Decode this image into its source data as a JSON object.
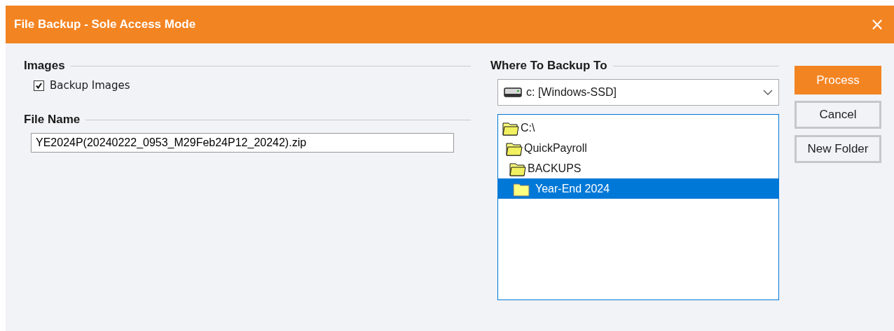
{
  "window": {
    "title": "File Backup - Sole Access Mode",
    "close": "×"
  },
  "images": {
    "heading": "Images",
    "checkbox": {
      "label": "Backup Images",
      "checked": true
    }
  },
  "file_name": {
    "heading": "File Name",
    "value": "YE2024P(20240222_0953_M29Feb24P12_20242).zip"
  },
  "destination": {
    "heading": "Where To Backup To",
    "drive": "c: [Windows-SSD]",
    "folders": [
      {
        "label": "C:\\",
        "selected": false,
        "children": [
          {
            "label": "QuickPayroll",
            "selected": false,
            "children": [
              {
                "label": "BACKUPS",
                "selected": false,
                "children": [
                  {
                    "label": "Year-End 2024",
                    "selected": true
                  }
                ]
              }
            ]
          }
        ]
      }
    ]
  },
  "buttons": [
    {
      "label": "Process",
      "kind": "primary"
    },
    {
      "label": "Cancel",
      "kind": "secondary"
    },
    {
      "label": "New Folder",
      "kind": "secondary"
    }
  ]
}
